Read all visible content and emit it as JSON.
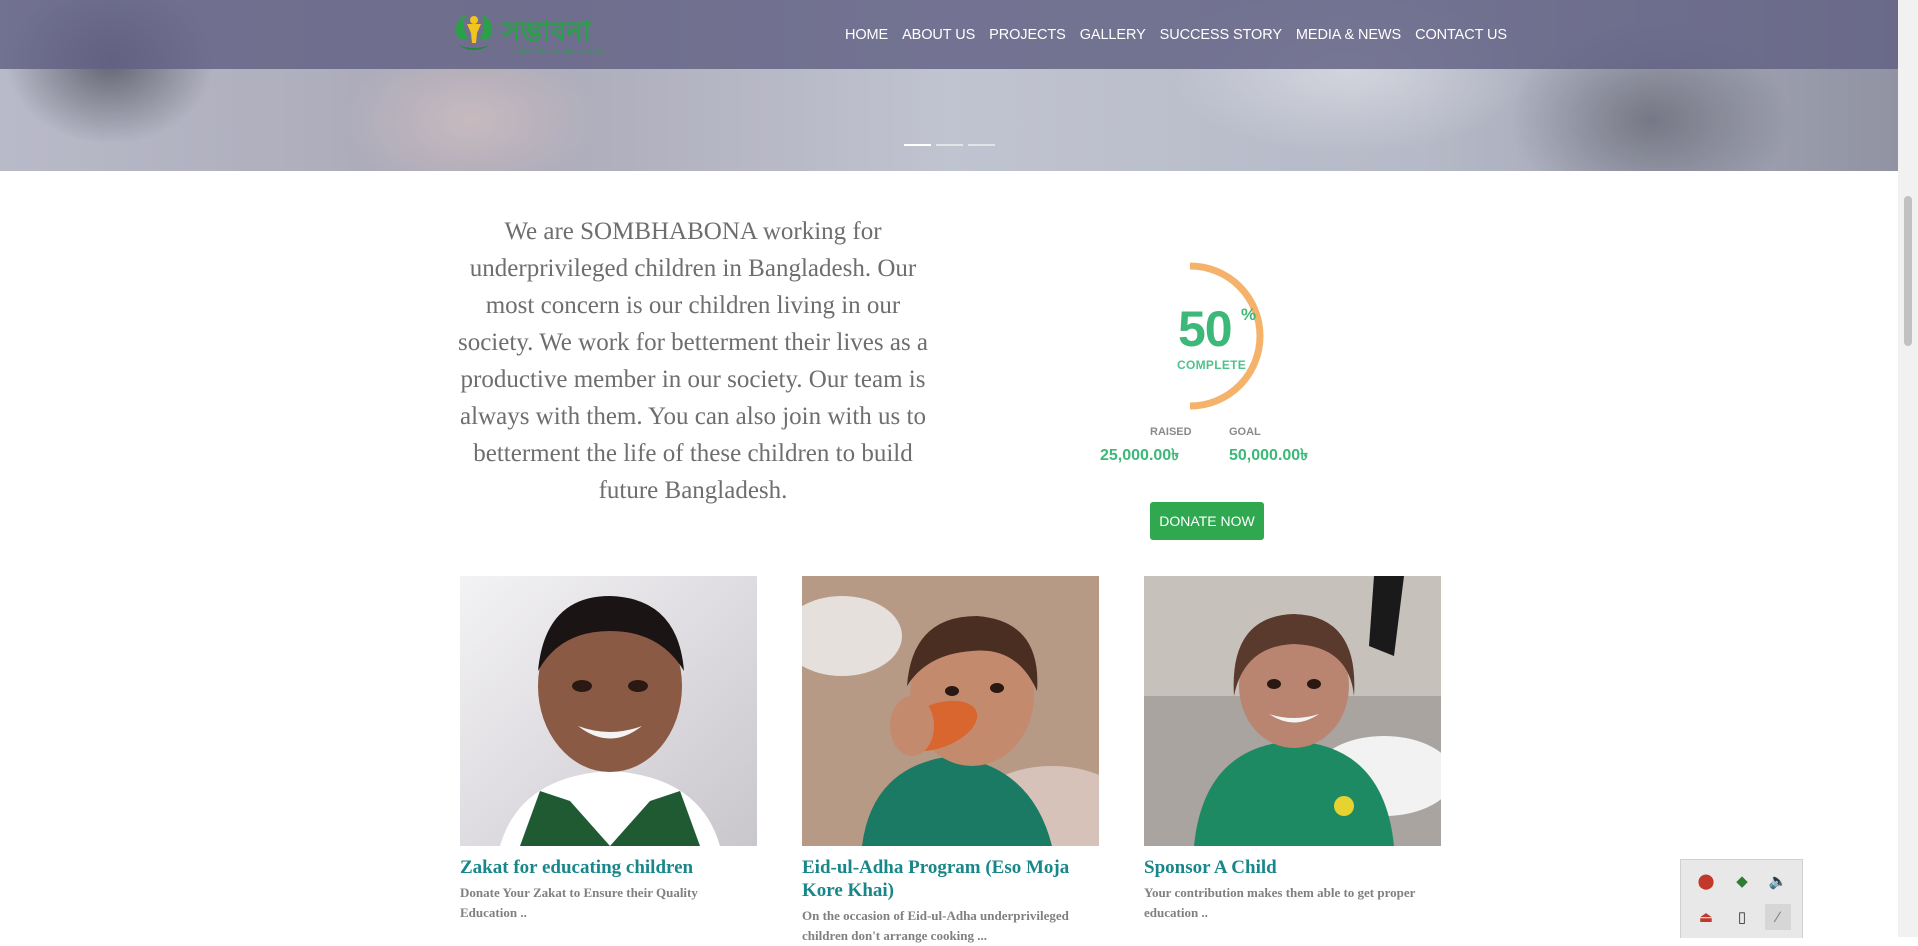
{
  "nav": {
    "logo_text": "সম্ভাবনা",
    "logo_tagline": "বঞ্চিত শিশুদের আশার আলো",
    "items": [
      "HOME",
      "ABOUT US",
      "PROJECTS",
      "GALLERY",
      "SUCCESS STORY",
      "MEDIA & NEWS",
      "CONTACT US"
    ]
  },
  "slider": {
    "slides": 3,
    "active": 0
  },
  "intro": {
    "text": "We are SOMBHABONA working for underprivileged children in Bangladesh. Our most concern is our children living in our society. We work for betterment their lives as a productive member in our society. Our team is always with them. You can also join with us to betterment the life of these children to build future Bangladesh."
  },
  "donation": {
    "percent": "50",
    "percent_fraction": 0.5,
    "percent_sign": "%",
    "complete_label": "COMPLETE",
    "raised_label": "RAISED",
    "raised_value": "25,000.00৳",
    "goal_label": "GOAL",
    "goal_value": "50,000.00৳",
    "donate_label": "DONATE NOW",
    "colors": {
      "ring": "#f4b26b",
      "text": "#3cb878",
      "button": "#2fa84f"
    }
  },
  "cards": [
    {
      "title": "Zakat for educating children",
      "desc": "Donate Your Zakat to Ensure their Quality Education .."
    },
    {
      "title": "Eid-ul-Adha Program (Eso Moja Kore Khai)",
      "desc": "On the occasion of Eid-ul-Adha underprivileged children don't arrange cooking ..."
    },
    {
      "title": "Sponsor A Child",
      "desc": "Your contribution makes them able to get proper education .."
    }
  ],
  "tray": {
    "icons": [
      "network-icon",
      "shield-icon",
      "speaker-icon",
      "usb-icon",
      "phone-icon",
      "feather-icon"
    ]
  }
}
